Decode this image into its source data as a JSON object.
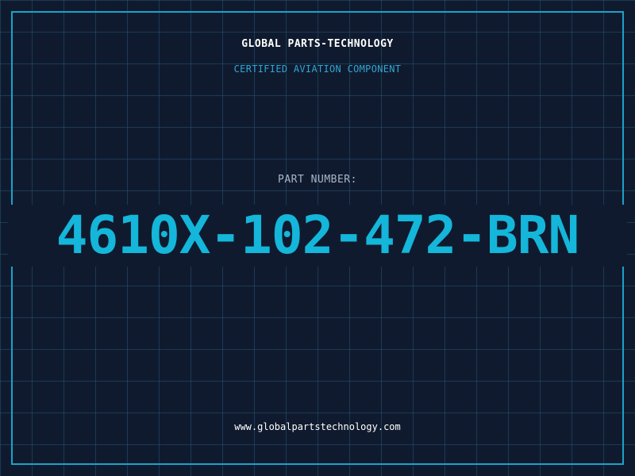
{
  "header": {
    "brand": "GLOBAL PARTS-TECHNOLOGY",
    "subtitle": "CERTIFIED AVIATION COMPONENT"
  },
  "part": {
    "label": "PART NUMBER:",
    "number": "4610X-102-472-BRN"
  },
  "footer": {
    "website": "www.globalpartstechnology.com"
  },
  "colors": {
    "background": "#101a2e",
    "grid": "#205674",
    "accent": "#14b6da",
    "frame": "#1aa3c8",
    "text": "#ffffff",
    "label": "#a8b6c8"
  }
}
